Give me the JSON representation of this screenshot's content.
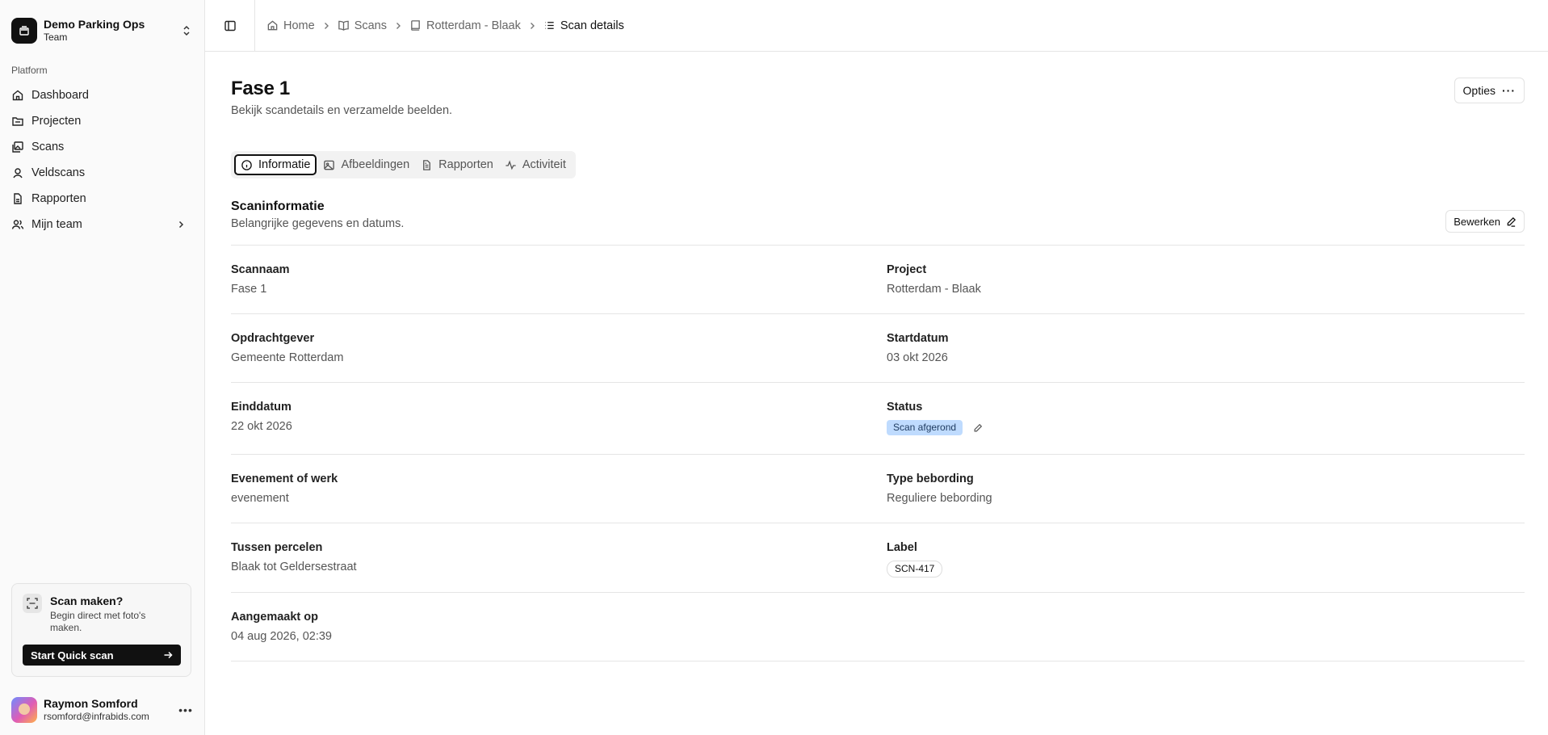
{
  "team": {
    "name": "Demo Parking Ops",
    "plan": "Team"
  },
  "sidebar": {
    "group_label": "Platform",
    "items": [
      {
        "label": "Dashboard",
        "icon": "home-icon"
      },
      {
        "label": "Projecten",
        "icon": "folder-icon"
      },
      {
        "label": "Scans",
        "icon": "images-icon"
      },
      {
        "label": "Veldscans",
        "icon": "map-pin-icon"
      },
      {
        "label": "Rapporten",
        "icon": "file-icon"
      },
      {
        "label": "Mijn team",
        "icon": "users-icon"
      }
    ]
  },
  "promo": {
    "title": "Scan maken?",
    "description": "Begin direct met foto's maken.",
    "button": "Start Quick scan"
  },
  "user": {
    "name": "Raymon Somford",
    "email": "rsomford@infrabids.com"
  },
  "breadcrumb": [
    "Home",
    "Scans",
    "Rotterdam - Blaak",
    "Scan details"
  ],
  "page": {
    "title": "Fase 1",
    "subtitle": "Bekijk scandetails en verzamelde beelden.",
    "options_label": "Opties"
  },
  "tabs": [
    "Informatie",
    "Afbeeldingen",
    "Rapporten",
    "Activiteit"
  ],
  "section": {
    "title": "Scaninformatie",
    "subtitle": "Belangrijke gegevens en datums.",
    "edit_label": "Bewerken"
  },
  "fields": {
    "scannaam": {
      "label": "Scannaam",
      "value": "Fase 1"
    },
    "project": {
      "label": "Project",
      "value": "Rotterdam - Blaak"
    },
    "opdrachtgever": {
      "label": "Opdrachtgever",
      "value": "Gemeente Rotterdam"
    },
    "startdatum": {
      "label": "Startdatum",
      "value": "03 okt 2026"
    },
    "einddatum": {
      "label": "Einddatum",
      "value": "22 okt 2026"
    },
    "status": {
      "label": "Status",
      "value": "Scan afgerond",
      "color": "#bfdbfe"
    },
    "evenement": {
      "label": "Evenement of werk",
      "value": "evenement"
    },
    "type_bebording": {
      "label": "Type bebording",
      "value": "Reguliere bebording"
    },
    "tussen_percelen": {
      "label": "Tussen percelen",
      "value": "Blaak tot Geldersestraat"
    },
    "label": {
      "label": "Label",
      "value": "SCN-417"
    },
    "aangemaakt_op": {
      "label": "Aangemaakt op",
      "value": "04 aug 2026, 02:39"
    }
  }
}
